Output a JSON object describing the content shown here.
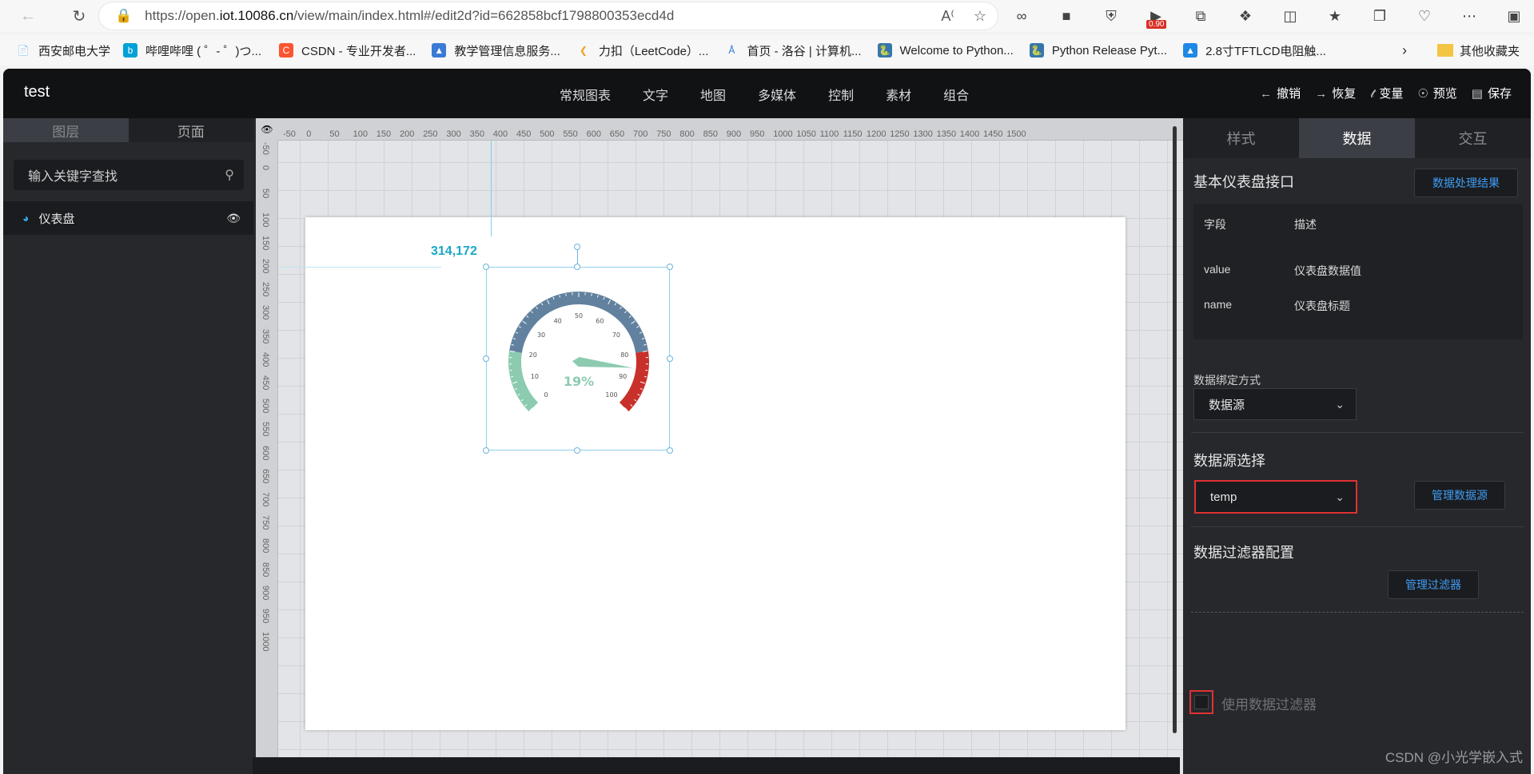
{
  "browser": {
    "url_prefix": "https://open.",
    "url_host": "iot.10086.cn",
    "url_rest": "/view/main/index.html#/edit2d?id=662858bcf1798800353ecd4d",
    "ext_badge": "0.90",
    "bookmarks": [
      {
        "label": "西安邮电大学",
        "color": "#666"
      },
      {
        "label": "哔哩哔哩 ( ゜- ゜)つ...",
        "color": "#00a1d6"
      },
      {
        "label": "CSDN - 专业开发者...",
        "color": "#fc5531"
      },
      {
        "label": "教学管理信息服务...",
        "color": "#3a7bd5"
      },
      {
        "label": "力扣（LeetCode）...",
        "color": "#f0a020"
      },
      {
        "label": "首页 - 洛谷 | 计算机...",
        "color": "#2f7bd6"
      },
      {
        "label": "Welcome to Python...",
        "color": "#3776ab"
      },
      {
        "label": "Python Release Pyt...",
        "color": "#3776ab"
      },
      {
        "label": "2.8寸TFTLCD电阻触...",
        "color": "#1e88e5"
      }
    ],
    "other_bookmarks": "其他收藏夹"
  },
  "app": {
    "title": "test",
    "menu": [
      "常规图表",
      "文字",
      "地图",
      "多媒体",
      "控制",
      "素材",
      "组合"
    ],
    "actions": {
      "undo": "撤销",
      "redo": "恢复",
      "variable": "变量",
      "preview": "预览",
      "save": "保存"
    }
  },
  "left_panel": {
    "tabs": [
      "图层",
      "页面"
    ],
    "search_placeholder": "输入关键字查找",
    "layers": [
      {
        "label": "仪表盘"
      }
    ]
  },
  "canvas": {
    "coord_label": "314,172",
    "ruler_x": [
      "-50",
      "0",
      "50",
      "100",
      "150",
      "200",
      "250",
      "300",
      "350",
      "400",
      "450",
      "500",
      "550",
      "600",
      "650",
      "700",
      "750",
      "800",
      "850",
      "900",
      "950",
      "1000",
      "1050",
      "1100",
      "1150",
      "1200",
      "1250",
      "1300",
      "1350",
      "1400",
      "1450",
      "1500"
    ],
    "ruler_y": [
      "-50",
      "0",
      "50",
      "100",
      "150",
      "200",
      "250",
      "300",
      "350",
      "400",
      "450",
      "500",
      "550",
      "600",
      "650",
      "700",
      "750",
      "800",
      "850",
      "900",
      "950",
      "1000"
    ],
    "gauge": {
      "value": 19,
      "value_text": "19%",
      "min": 0,
      "max": 100,
      "labels": [
        "0",
        "10",
        "20",
        "30",
        "40",
        "50",
        "60",
        "70",
        "80",
        "90",
        "100"
      ],
      "colors": {
        "low": "#8ccbb0",
        "mid": "#61819f",
        "high": "#c8302b",
        "pointer": "#8ccbb0"
      }
    }
  },
  "right_panel": {
    "tabs": [
      "样式",
      "数据",
      "交互"
    ],
    "api_title": "基本仪表盘接口",
    "process_result_btn": "数据处理结果",
    "table_header": {
      "field": "字段",
      "desc": "描述"
    },
    "fields": [
      {
        "field": "value",
        "desc": "仪表盘数据值"
      },
      {
        "field": "name",
        "desc": "仪表盘标题"
      }
    ],
    "binding_label": "数据绑定方式",
    "binding_value": "数据源",
    "source_title": "数据源选择",
    "source_value": "temp",
    "manage_source_btn": "管理数据源",
    "filter_title": "数据过滤器配置",
    "use_filter_label": "使用数据过滤器",
    "manage_filter_btn": "管理过滤器"
  },
  "watermark": "CSDN @小光学嵌入式"
}
